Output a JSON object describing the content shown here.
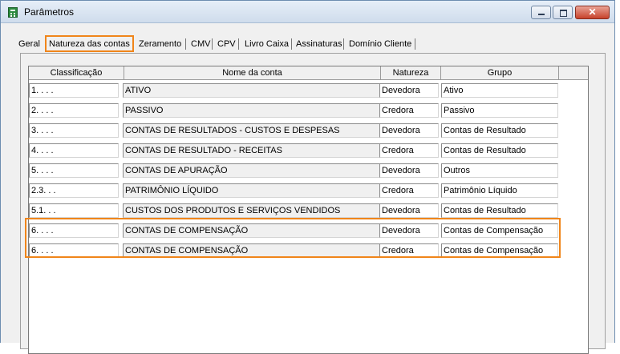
{
  "window": {
    "title": "Parâmetros"
  },
  "tabs": [
    {
      "label": "Geral"
    },
    {
      "label": "Natureza das contas"
    },
    {
      "label": "Zeramento"
    },
    {
      "label": "CMV"
    },
    {
      "label": "CPV"
    },
    {
      "label": "Livro Caixa"
    },
    {
      "label": "Assinaturas"
    },
    {
      "label": "Domínio Cliente"
    }
  ],
  "active_tab": "Natureza das contas",
  "highlight_color": "#f0851a",
  "table": {
    "columns": [
      "Classificação",
      "Nome da conta",
      "Natureza",
      "Grupo"
    ],
    "rows": [
      {
        "classificacao": "1. . . .",
        "nome": "ATIVO",
        "natureza": "Devedora",
        "grupo": "Ativo"
      },
      {
        "classificacao": "2. . . .",
        "nome": "PASSIVO",
        "natureza": "Credora",
        "grupo": "Passivo"
      },
      {
        "classificacao": "3. . . .",
        "nome": "CONTAS DE RESULTADOS - CUSTOS E DESPESAS",
        "natureza": "Devedora",
        "grupo": "Contas de Resultado"
      },
      {
        "classificacao": "4. . . .",
        "nome": "CONTAS DE RESULTADO - RECEITAS",
        "natureza": "Credora",
        "grupo": "Contas de Resultado"
      },
      {
        "classificacao": "5. . . .",
        "nome": "CONTAS DE APURAÇÃO",
        "natureza": "Devedora",
        "grupo": "Outros"
      },
      {
        "classificacao": "2.3. . .",
        "nome": "PATRIMÔNIO LÍQUIDO",
        "natureza": "Credora",
        "grupo": "Patrimônio Líquido"
      },
      {
        "classificacao": "5.1. . .",
        "nome": "CUSTOS DOS PRODUTOS E SERVIÇOS VENDIDOS",
        "natureza": "Devedora",
        "grupo": "Contas de Resultado"
      },
      {
        "classificacao": "6. . . .",
        "nome": "CONTAS DE COMPENSAÇÃO",
        "natureza": "Devedora",
        "grupo": "Contas de Compensação"
      },
      {
        "classificacao": "6. . . .",
        "nome": "CONTAS DE COMPENSAÇÃO",
        "natureza": "Credora",
        "grupo": "Contas de Compensação"
      }
    ]
  }
}
